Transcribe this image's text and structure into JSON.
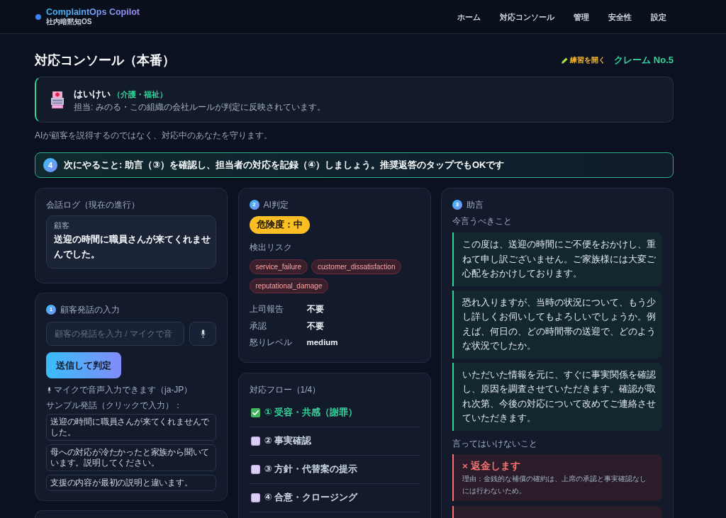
{
  "header": {
    "logo": "ComplaintOps Copilot",
    "subtitle": "社内暗黙知OS",
    "nav": [
      "ホーム",
      "対応コンソール",
      "管理",
      "安全性",
      "設定"
    ]
  },
  "page": {
    "title": "対応コンソール（本番）",
    "practice_link": "練習を開く",
    "claim_number": "クレーム No.5"
  },
  "organization": {
    "name": "はいけい",
    "industry": "（介護・福祉）",
    "note": "担当: みのる・この組織の会社ルールが判定に反映されています。"
  },
  "tagline": "AIが顧客を説得するのではなく、対応中のあなたを守ります。",
  "next_step": {
    "number": "4",
    "text": "次にやること: 助言（③）を確認し、担当者の対応を記録（④）しましょう。推奨返答のタップでもOKです"
  },
  "conversation_log": {
    "title": "会話ログ（現在の進行）",
    "messages": [
      {
        "speaker": "顧客",
        "text": "送迎の時間に職員さんが来てくれませんでした。"
      }
    ]
  },
  "customer_input": {
    "number": "1",
    "title": "顧客発話の入力",
    "placeholder": "顧客の発話を入力 / マイクで音",
    "send_button": "送信して判定",
    "mic_note": "マイクで音声入力できます（ja-JP）",
    "samples_label": "サンプル発話（クリックで入力）：",
    "samples": [
      "送迎の時間に職員さんが来てくれませんでした。",
      "母への対応が冷たかったと家族から聞いています。説明してください。",
      "支援の内容が最初の説明と違います。"
    ]
  },
  "ai_judgment": {
    "number": "2",
    "title": "AI判定",
    "risk_badge": "危険度：中",
    "risks_label": "検出リスク",
    "risks": [
      "service_failure",
      "customer_dissatisfaction",
      "reputational_damage"
    ],
    "details": [
      {
        "label": "上司報告",
        "value": "不要"
      },
      {
        "label": "承認",
        "value": "不要"
      },
      {
        "label": "怒りレベル",
        "value": "medium"
      }
    ]
  },
  "response_flow": {
    "title": "対応フロー（1/4）",
    "steps": [
      {
        "label": "① 受容・共感（謝罪）",
        "done": true
      },
      {
        "label": "② 事実確認",
        "done": false
      },
      {
        "label": "③ 方針・代替案の提示",
        "done": false
      },
      {
        "label": "④ 合意・クロージング",
        "done": false
      }
    ]
  },
  "advice": {
    "number": "3",
    "title": "助言",
    "say_label": "今言うべきこと",
    "say": [
      "この度は、送迎の時間にご不便をおかけし、重ねて申し訳ございません。ご家族様には大変ご心配をおかけしております。",
      "恐れ入りますが、当時の状況について、もう少し詳しくお伺いしてもよろしいでしょうか。例えば、何日の、どの時間帯の送迎で、どのような状況でしたか。",
      "いただいた情報を元に、すぐに事実関係を確認し、原因を調査させていただきます。確認が取れ次第、今後の対応について改めてご連絡させていただきます。"
    ],
    "avoid_label": "言ってはいけないこと",
    "avoid": [
      {
        "phrase": "× 返金します",
        "reason": "理由：金銭的な補償の確約は、上席の承認と事実確認なしには行わないため。"
      }
    ]
  }
}
